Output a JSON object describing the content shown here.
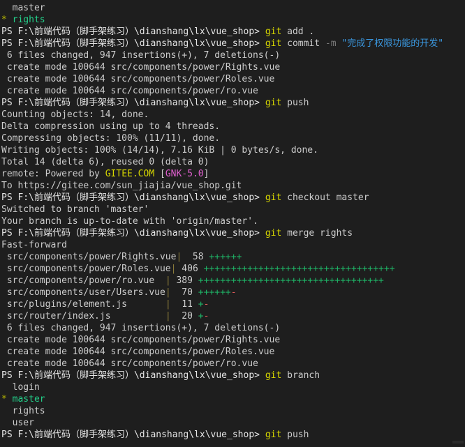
{
  "terminal": {
    "app": "powershell-terminal",
    "background": "#1e1e1e",
    "foreground": "#cccccc",
    "font_size_px": 13,
    "line_height_px": 17,
    "prompt_prefix": "PS ",
    "working_directory": "F:\\前端代码（脚手架练习）\\dianshang\\lx\\vue_shop",
    "prompt_suffix": "> ",
    "colors": {
      "default": "#cccccc",
      "command": "#d7d700",
      "branch_current": "#23d18b",
      "asterisk": "#b5b500",
      "string": "#3a96dd",
      "flag": "#7a7a7a",
      "insertion": "#23d18b",
      "deletion": "#e05a5a",
      "vendor": "#d7d700",
      "version_tag": "#e05fcf",
      "separator_bar": "#8a7a3a"
    }
  },
  "lines": [
    {
      "id": "branch-master-top",
      "type": "branch",
      "marker": "  ",
      "name": "master",
      "current": false
    },
    {
      "id": "branch-rights-top",
      "type": "branch",
      "marker": "* ",
      "name": "rights",
      "current": true
    },
    {
      "id": "prompt-git-add",
      "type": "prompt",
      "command": "git",
      "args": " add ."
    },
    {
      "id": "prompt-git-commit",
      "type": "prompt-commit",
      "command": "git",
      "subcommand": " commit ",
      "flag": "-m",
      "message": " \"完成了权限功能的开发\""
    },
    {
      "id": "commit-stat-1",
      "type": "plain",
      "text": " 6 files changed, 947 insertions(+), 7 deletions(-)"
    },
    {
      "id": "create-1",
      "type": "plain",
      "text": " create mode 100644 src/components/power/Rights.vue"
    },
    {
      "id": "create-2",
      "type": "plain",
      "text": " create mode 100644 src/components/power/Roles.vue"
    },
    {
      "id": "create-3",
      "type": "plain",
      "text": " create mode 100644 src/components/power/ro.vue"
    },
    {
      "id": "prompt-git-push-1",
      "type": "prompt",
      "command": "git",
      "args": " push"
    },
    {
      "id": "push-1",
      "type": "plain",
      "text": "Counting objects: 14, done."
    },
    {
      "id": "push-2",
      "type": "plain",
      "text": "Delta compression using up to 4 threads."
    },
    {
      "id": "push-3",
      "type": "plain",
      "text": "Compressing objects: 100% (11/11), done."
    },
    {
      "id": "push-4",
      "type": "plain",
      "text": "Writing objects: 100% (14/14), 7.16 KiB | 0 bytes/s, done."
    },
    {
      "id": "push-5",
      "type": "plain",
      "text": "Total 14 (delta 6), reused 0 (delta 0)"
    },
    {
      "id": "push-remote",
      "type": "remote",
      "prefix": "remote: Powered by ",
      "vendor": "GITEE.COM",
      "open_bracket": " [",
      "tag": "GNK-5.0",
      "close_bracket": "]"
    },
    {
      "id": "push-to",
      "type": "plain",
      "text": "To https://gitee.com/sun_jiajia/vue_shop.git"
    },
    {
      "id": "prompt-git-checkout",
      "type": "prompt",
      "command": "git",
      "args": " checkout master"
    },
    {
      "id": "checkout-1",
      "type": "plain",
      "text": "Switched to branch 'master'"
    },
    {
      "id": "checkout-2",
      "type": "plain",
      "text": "Your branch is up-to-date with 'origin/master'."
    },
    {
      "id": "prompt-git-merge",
      "type": "prompt",
      "command": "git",
      "args": " merge rights"
    },
    {
      "id": "merge-1",
      "type": "plain",
      "text": "Fast-forward"
    },
    {
      "id": "diffstat-1",
      "type": "diffstat",
      "file": " src/components/power/Rights.vue",
      "count": "58",
      "plus": 6,
      "minus": 0
    },
    {
      "id": "diffstat-2",
      "type": "diffstat",
      "file": " src/components/power/Roles.vue",
      "count": "406",
      "plus": 35,
      "minus": 0
    },
    {
      "id": "diffstat-3",
      "type": "diffstat",
      "file": " src/components/power/ro.vue",
      "count": "389",
      "plus": 34,
      "minus": 0
    },
    {
      "id": "diffstat-4",
      "type": "diffstat",
      "file": " src/components/user/Users.vue",
      "count": "70",
      "plus": 6,
      "minus": 1
    },
    {
      "id": "diffstat-5",
      "type": "diffstat",
      "file": " src/plugins/element.js",
      "count": "11",
      "plus": 1,
      "minus": 1
    },
    {
      "id": "diffstat-6",
      "type": "diffstat",
      "file": " src/router/index.js",
      "count": "20",
      "plus": 1,
      "minus": 1
    },
    {
      "id": "merge-stat",
      "type": "plain",
      "text": " 6 files changed, 947 insertions(+), 7 deletions(-)"
    },
    {
      "id": "merge-create-1",
      "type": "plain",
      "text": " create mode 100644 src/components/power/Rights.vue"
    },
    {
      "id": "merge-create-2",
      "type": "plain",
      "text": " create mode 100644 src/components/power/Roles.vue"
    },
    {
      "id": "merge-create-3",
      "type": "plain",
      "text": " create mode 100644 src/components/power/ro.vue"
    },
    {
      "id": "prompt-git-branch",
      "type": "prompt",
      "command": "git",
      "args": " branch"
    },
    {
      "id": "branch-login",
      "type": "branch",
      "marker": "  ",
      "name": "login",
      "current": false
    },
    {
      "id": "branch-master",
      "type": "branch",
      "marker": "* ",
      "name": "master",
      "current": true
    },
    {
      "id": "branch-rights",
      "type": "branch",
      "marker": "  ",
      "name": "rights",
      "current": false
    },
    {
      "id": "branch-user",
      "type": "branch",
      "marker": "  ",
      "name": "user",
      "current": false
    },
    {
      "id": "prompt-git-push-2",
      "type": "prompt",
      "command": "git",
      "args": " push"
    }
  ],
  "diffstat_layout": {
    "file_column_width": 30,
    "count_column_width": 4,
    "bar_char": "|",
    "plus_char": "+",
    "minus_char": "-"
  }
}
